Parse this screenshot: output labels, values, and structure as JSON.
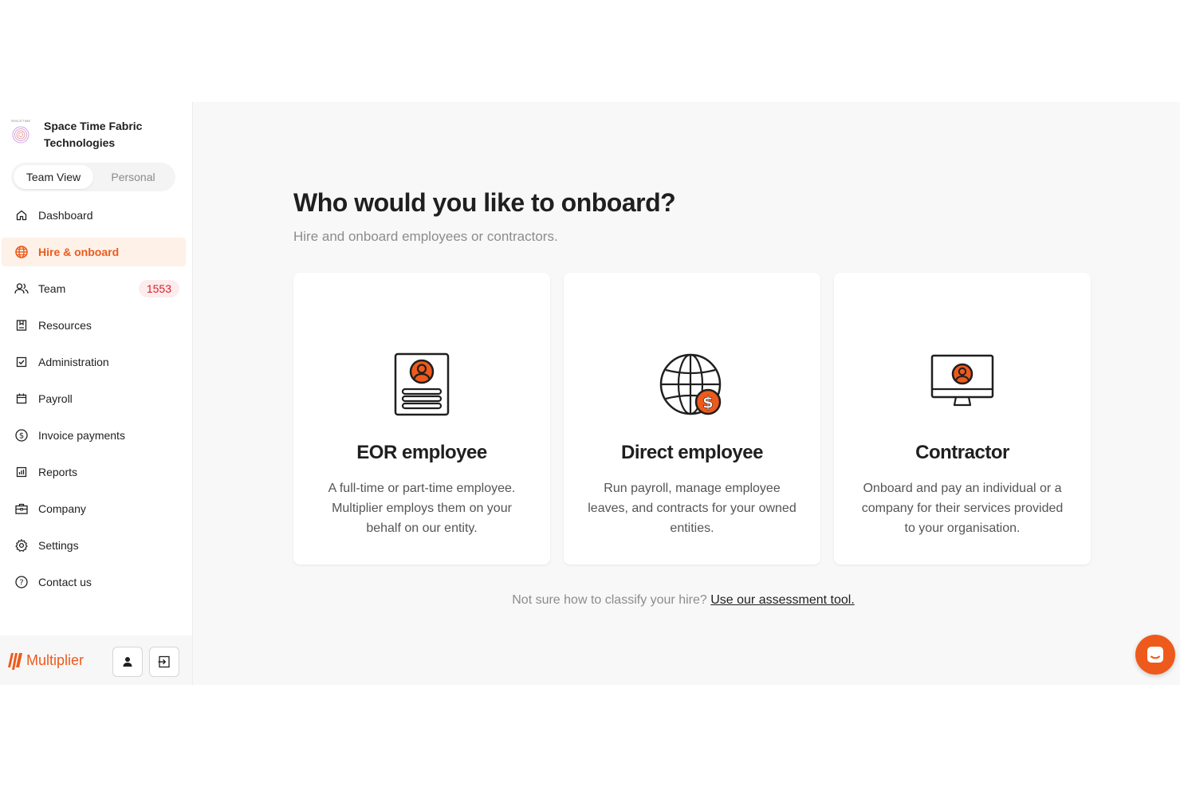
{
  "org": {
    "logo_text": "SPACETIME",
    "name_line1": "Space Time Fabric",
    "name_line2": "Technologies"
  },
  "view_toggle": {
    "team": "Team View",
    "personal": "Personal",
    "selected": "Team View"
  },
  "sidebar": {
    "items": [
      {
        "label": "Dashboard",
        "icon": "home-icon"
      },
      {
        "label": "Hire & onboard",
        "icon": "globe-icon",
        "active": true
      },
      {
        "label": "Team",
        "icon": "people-icon",
        "badge": "1553"
      },
      {
        "label": "Resources",
        "icon": "book-icon"
      },
      {
        "label": "Administration",
        "icon": "checkbox-icon"
      },
      {
        "label": "Payroll",
        "icon": "calendar-icon"
      },
      {
        "label": "Invoice payments",
        "icon": "dollar-circle-icon"
      },
      {
        "label": "Reports",
        "icon": "bar-chart-icon"
      },
      {
        "label": "Company",
        "icon": "briefcase-icon"
      },
      {
        "label": "Settings",
        "icon": "gear-icon"
      },
      {
        "label": "Contact us",
        "icon": "question-circle-icon"
      }
    ]
  },
  "footer": {
    "brand": "Multiplier"
  },
  "main": {
    "title": "Who would you like to onboard?",
    "subtitle": "Hire and onboard employees or contractors.",
    "cards": [
      {
        "title": "EOR employee",
        "description": "A full-time or part-time employee. Multiplier employs them on your behalf on our entity.",
        "icon": "id-document-icon"
      },
      {
        "title": "Direct employee",
        "description": "Run payroll, manage employee leaves, and contracts for your owned entities.",
        "icon": "globe-dollar-icon"
      },
      {
        "title": "Contractor",
        "description": "Onboard and pay an individual or a company for their services provided to your organisation.",
        "icon": "monitor-user-icon"
      }
    ],
    "assessment_prefix": "Not sure how to classify your hire?",
    "assessment_link": "Use our assessment tool."
  },
  "colors": {
    "accent": "#ee5a1b",
    "active_bg": "#fdf1e8",
    "badge_text": "#d4212b",
    "badge_bg": "#fdecec",
    "main_bg": "#f8f8f8"
  }
}
